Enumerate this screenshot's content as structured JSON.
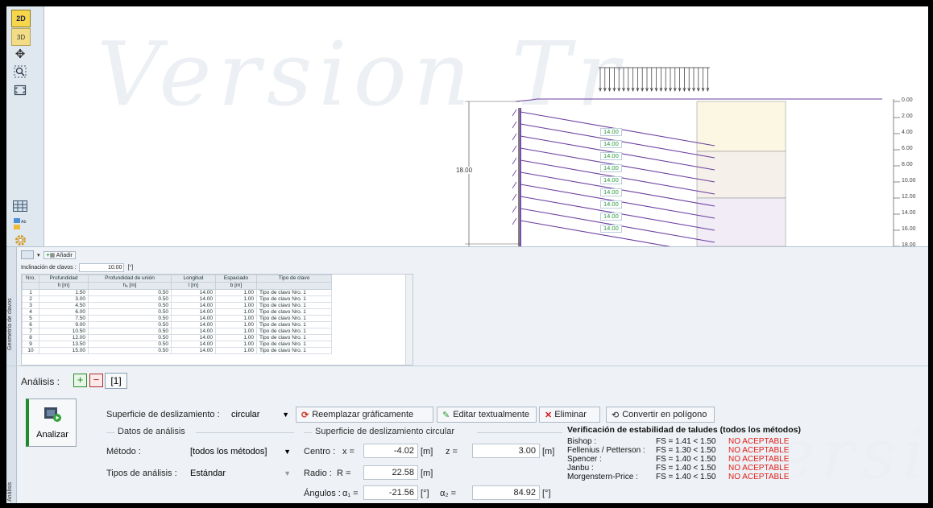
{
  "toolbar": {
    "btn_2d": "2D",
    "btn_3d": "3D"
  },
  "watermarks": {
    "top": "Version Tr",
    "bottom": "Versio"
  },
  "drawing": {
    "height_label": "18.00",
    "nail_length_label": "14.00",
    "depth_ticks": [
      "0.00",
      "2.00",
      "4.00",
      "6.00",
      "8.00",
      "10.00",
      "12.00",
      "14.00",
      "16.00",
      "18.00"
    ]
  },
  "geometry_panel": {
    "add_label": "Añadir",
    "inclination_label": "Inclinación de clavos :",
    "inclination_value": "10.00",
    "inclination_unit": "[°]",
    "side_label": "Geometría de clavos",
    "headers": [
      {
        "t": "Nro.",
        "u": ""
      },
      {
        "t": "Profundidad",
        "u": "h [m]"
      },
      {
        "t": "Profundidad de unión",
        "u": "hₐ [m]"
      },
      {
        "t": "Longitud",
        "u": "l [m]"
      },
      {
        "t": "Espaciado",
        "u": "b [m]"
      },
      {
        "t": "Tipo de clavo",
        "u": ""
      }
    ],
    "rows": [
      [
        "1",
        "1.50",
        "0.50",
        "14.00",
        "1.00",
        "Tipo de clavo Nro. 1"
      ],
      [
        "2",
        "3.00",
        "0.50",
        "14.00",
        "1.00",
        "Tipo de clavo Nro. 1"
      ],
      [
        "3",
        "4.50",
        "0.50",
        "14.00",
        "1.00",
        "Tipo de clavo Nro. 1"
      ],
      [
        "4",
        "6.00",
        "0.50",
        "14.00",
        "1.00",
        "Tipo de clavo Nro. 1"
      ],
      [
        "5",
        "7.50",
        "0.50",
        "14.00",
        "1.00",
        "Tipo de clavo Nro. 1"
      ],
      [
        "6",
        "9.00",
        "0.50",
        "14.00",
        "1.00",
        "Tipo de clavo Nro. 1"
      ],
      [
        "7",
        "10.50",
        "0.50",
        "14.00",
        "1.00",
        "Tipo de clavo Nro. 1"
      ],
      [
        "8",
        "12.00",
        "0.50",
        "14.00",
        "1.00",
        "Tipo de clavo Nro. 1"
      ],
      [
        "9",
        "13.50",
        "0.50",
        "14.00",
        "1.00",
        "Tipo de clavo Nro. 1"
      ],
      [
        "10",
        "15.00",
        "0.50",
        "14.00",
        "1.00",
        "Tipo de clavo Nro. 1"
      ]
    ]
  },
  "analysis_panel": {
    "tab_label": "Análisis :",
    "tab_item": "[1]",
    "side_label": "Análisis",
    "analyze_button": "Analizar",
    "slip_surface_label": "Superficie de deslizamiento :",
    "slip_surface_value": "circular",
    "replace_graphically": "Reemplazar gráficamente",
    "edit_textually": "Editar textualmente",
    "delete": "Eliminar",
    "convert_polygon": "Convertir en polígono",
    "data_group": "Datos de análisis",
    "method_label": "Método :",
    "method_value": "[todos los métodos]",
    "analysis_type_label": "Tipos de análisis :",
    "analysis_type_value": "Estándar",
    "circle_group": "Superficie de deslizamiento circular",
    "center_label": "Centro :",
    "x_label": "x =",
    "x_value": "-4.02",
    "z_label": "z =",
    "z_value": "3.00",
    "unit_m": "[m]",
    "radius_label": "Radio :",
    "r_label": "R =",
    "r_value": "22.58",
    "angles_label": "Ángulos :",
    "a1_label": "α₁ =",
    "a1_value": "-21.56",
    "a2_label": "α₂ =",
    "a2_value": "84.92",
    "unit_deg": "[°]"
  },
  "verification": {
    "title": "Verificación de estabilidad de taludes (todos los métodos)",
    "rows": [
      {
        "method": "Bishop :",
        "fs": "FS = 1.41 < 1.50",
        "result": "NO ACEPTABLE"
      },
      {
        "method": "Fellenius / Petterson :",
        "fs": "FS = 1.30 < 1.50",
        "result": "NO ACEPTABLE"
      },
      {
        "method": "Spencer :",
        "fs": "FS = 1.40 < 1.50",
        "result": "NO ACEPTABLE"
      },
      {
        "method": "Janbu :",
        "fs": "FS = 1.40 < 1.50",
        "result": "NO ACEPTABLE"
      },
      {
        "method": "Morgenstern-Price :",
        "fs": "FS = 1.40 < 1.50",
        "result": "NO ACEPTABLE"
      }
    ]
  }
}
